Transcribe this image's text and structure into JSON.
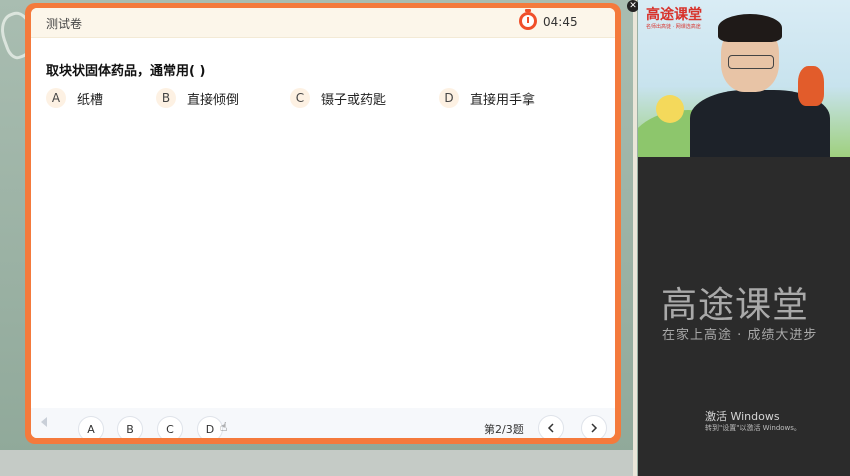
{
  "quiz": {
    "title": "测试卷",
    "timer": "04:45",
    "question": "取块状固体药品，通常用(  )",
    "options": [
      {
        "letter": "A",
        "text": "纸槽"
      },
      {
        "letter": "B",
        "text": "直接倾倒"
      },
      {
        "letter": "C",
        "text": "镊子或药匙"
      },
      {
        "letter": "D",
        "text": "直接用手拿"
      }
    ],
    "answer_buttons": [
      "A",
      "B",
      "C",
      "D"
    ],
    "page_count": "第2/3题"
  },
  "camera": {
    "logo": "高途课堂",
    "logo_sub": "名师出高徒 · 网课选高途"
  },
  "panel": {
    "brand": "高途课堂",
    "slogan": "在家上高途 · 成绩大进步",
    "watermark_title": "激活 Windows",
    "watermark_sub": "转到\"设置\"以激活 Windows。"
  },
  "icons": [
    "timer-icon",
    "close-icon",
    "prev-arrow-icon",
    "chevron-left-icon",
    "chevron-right-icon",
    "pointer-cursor-icon"
  ],
  "colors": {
    "accent": "#f47a3c",
    "timer": "#f04f2a",
    "header_bg": "#fcf6ea"
  }
}
